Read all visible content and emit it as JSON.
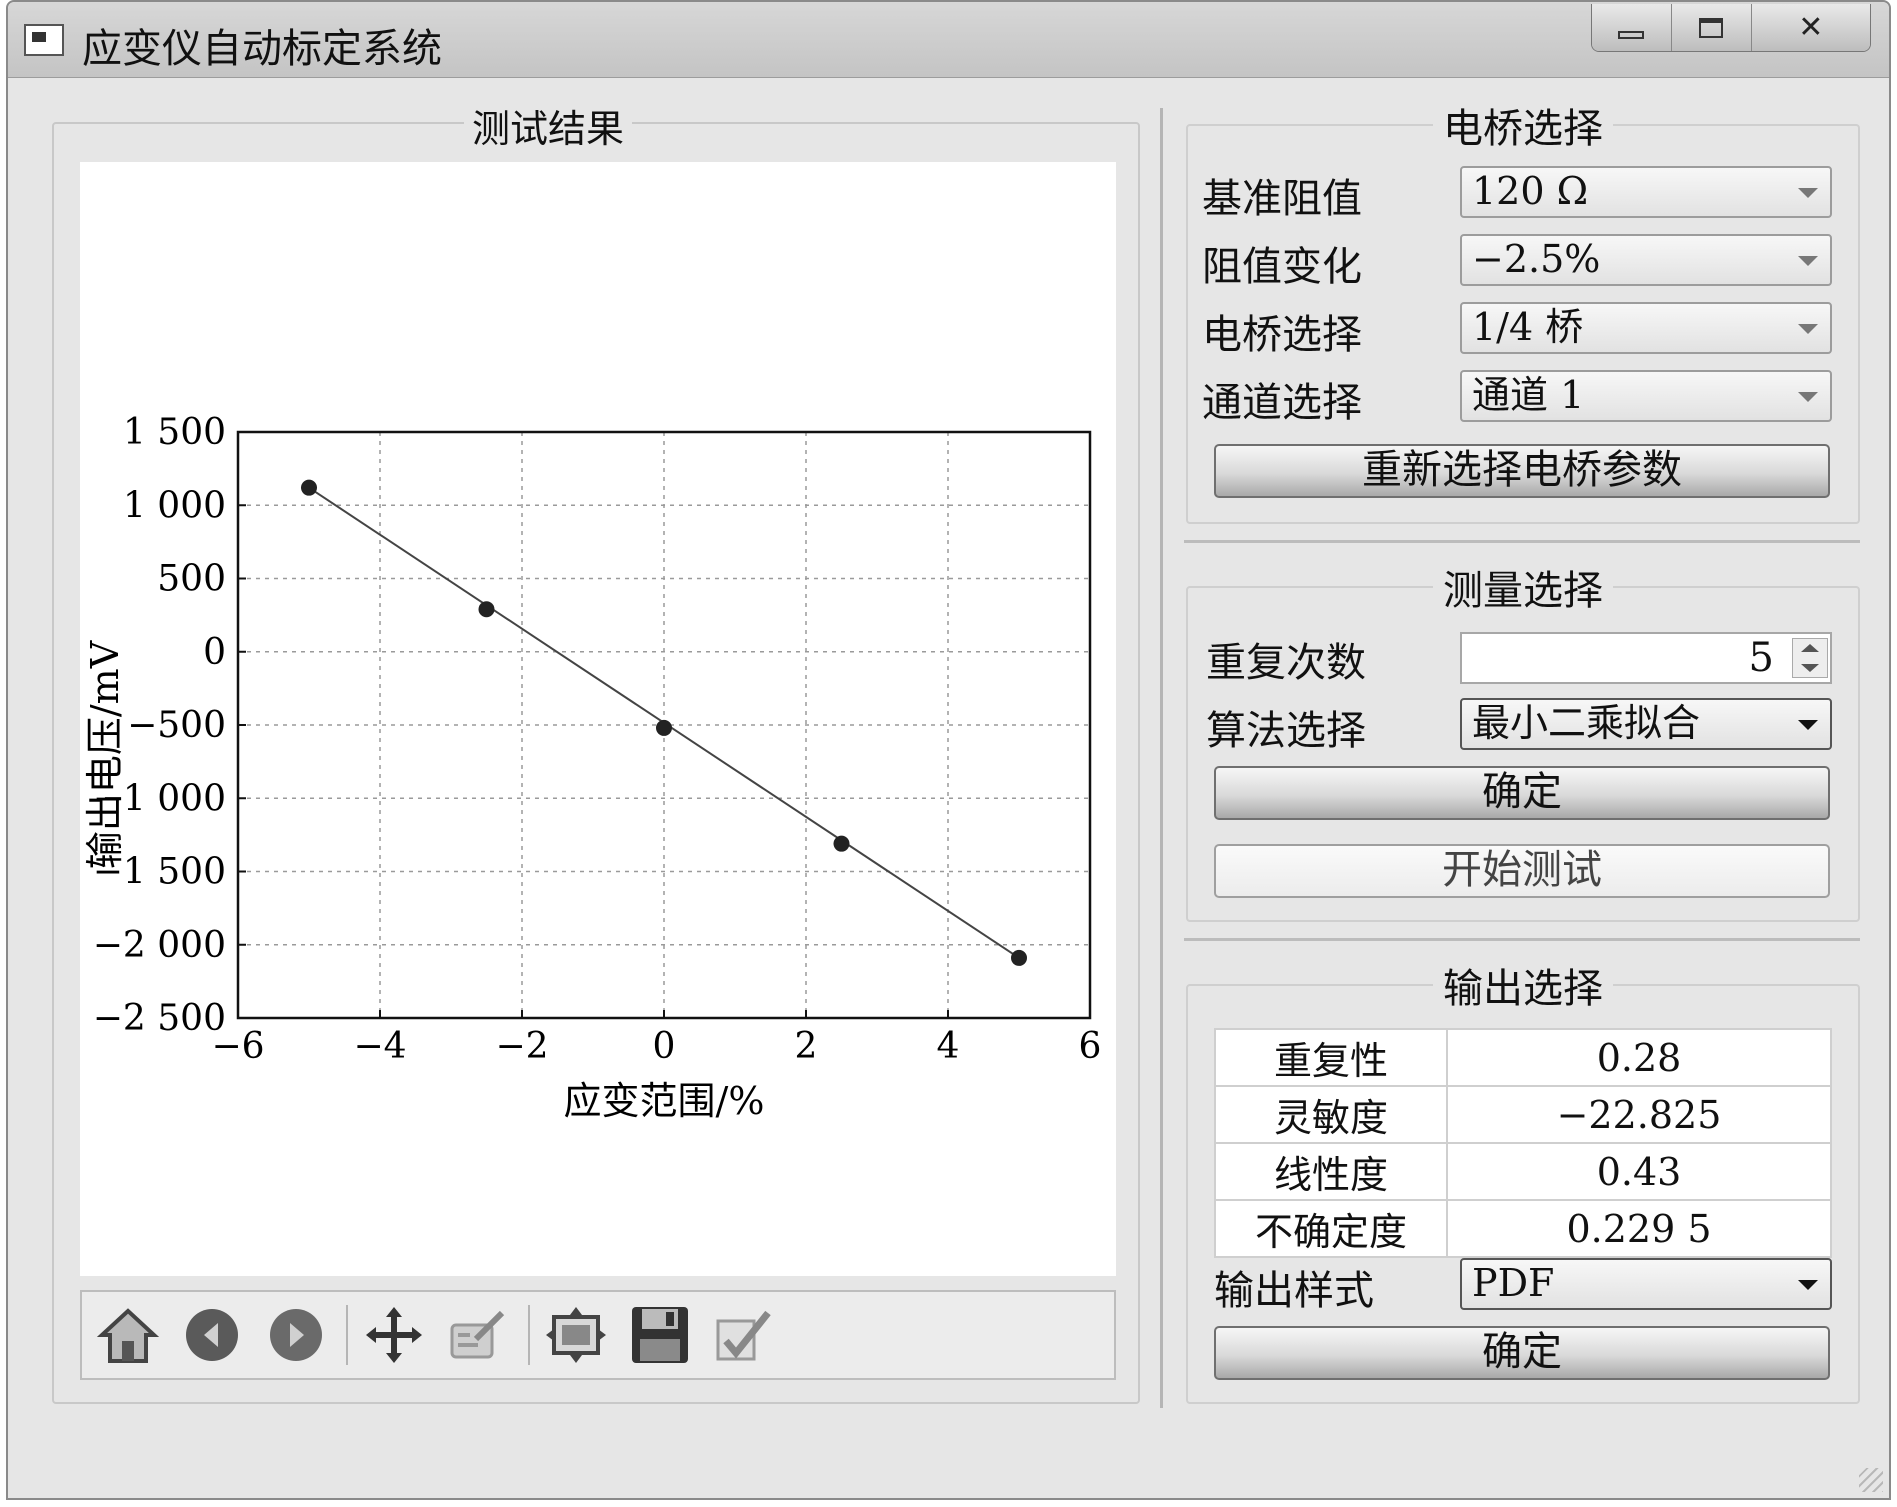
{
  "window": {
    "title": "应变仪自动标定系统"
  },
  "left_panel": {
    "title": "测试结果"
  },
  "chart_data": {
    "type": "scatter",
    "xlabel": "应变范围/%",
    "ylabel": "输出电压/mV",
    "xlim": [
      -6,
      6
    ],
    "ylim": [
      -2500,
      1500
    ],
    "xticks": [
      -6,
      -4,
      -2,
      0,
      2,
      4,
      6
    ],
    "xtick_labels": [
      "−6",
      "−4",
      "−2",
      "0",
      "2",
      "4",
      "6"
    ],
    "yticks": [
      1500,
      1000,
      500,
      0,
      -500,
      -1000,
      -1500,
      -2000,
      -2500
    ],
    "ytick_labels": [
      "1 500",
      "1 000",
      "500",
      "0",
      "−500",
      "−1 000",
      "−1 500",
      "−2 000",
      "−2 500"
    ],
    "grid": true,
    "points": [
      {
        "x": -5,
        "y": 1120
      },
      {
        "x": -2.5,
        "y": 290
      },
      {
        "x": 0,
        "y": -520
      },
      {
        "x": 2.5,
        "y": -1310
      },
      {
        "x": 5,
        "y": -2090
      }
    ],
    "fit_line": {
      "x": [
        -5,
        5
      ],
      "y": [
        1120,
        -2090
      ]
    }
  },
  "toolbar": {
    "icons": [
      "home-icon",
      "back-icon",
      "forward-icon",
      "pan-icon",
      "zoom-icon",
      "configure-subplots-icon",
      "save-icon",
      "edit-icon"
    ]
  },
  "bridge": {
    "title": "电桥选择",
    "ref_resistance_label": "基准阻值",
    "ref_resistance_value": "120 Ω",
    "resistance_change_label": "阻值变化",
    "resistance_change_value": "−2.5%",
    "bridge_label": "电桥选择",
    "bridge_value": "1/4 桥",
    "channel_label": "通道选择",
    "channel_value": "通道 1",
    "reselect_button": "重新选择电桥参数"
  },
  "measure": {
    "title": "测量选择",
    "repeat_label": "重复次数",
    "repeat_value": "5",
    "algorithm_label": "算法选择",
    "algorithm_value": "最小二乘拟合",
    "confirm_button": "确定",
    "start_button": "开始测试"
  },
  "output": {
    "title": "输出选择",
    "rows": [
      {
        "label": "重复性",
        "value": "0.28"
      },
      {
        "label": "灵敏度",
        "value": "−22.825"
      },
      {
        "label": "线性度",
        "value": "0.43"
      },
      {
        "label": "不确定度",
        "value": "0.229 5"
      }
    ],
    "format_label": "输出样式",
    "format_value": "PDF",
    "confirm_button": "确定"
  }
}
